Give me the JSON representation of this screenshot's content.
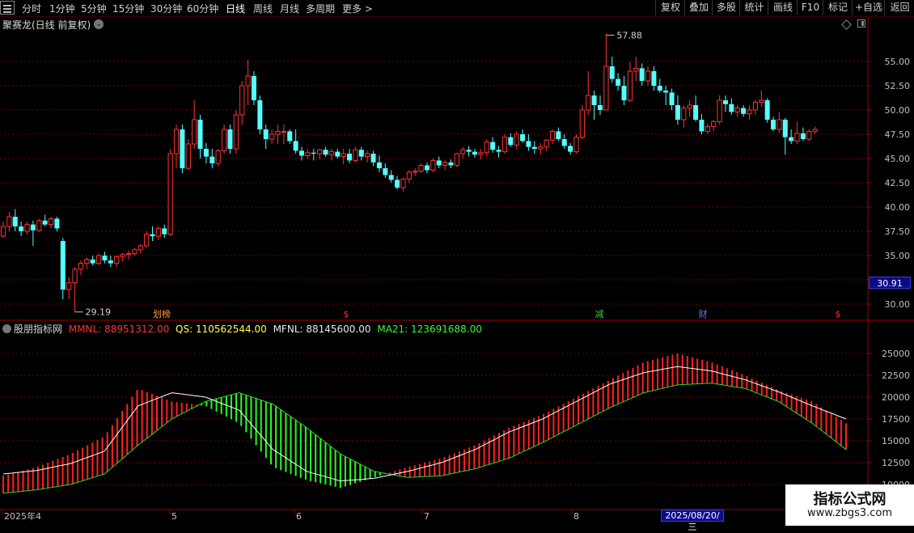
{
  "toolbar": {
    "periods": [
      {
        "label": "分时",
        "active": false
      },
      {
        "label": "1分钟",
        "active": false
      },
      {
        "label": "5分钟",
        "active": false
      },
      {
        "label": "15分钟",
        "active": false
      },
      {
        "label": "30分钟",
        "active": false
      },
      {
        "label": "60分钟",
        "active": false
      },
      {
        "label": "日线",
        "active": true
      },
      {
        "label": "周线",
        "active": false
      },
      {
        "label": "月线",
        "active": false
      },
      {
        "label": "多周期",
        "active": false
      }
    ],
    "more_label": "更多 >",
    "right_buttons": [
      "复权",
      "叠加",
      "多股",
      "统计",
      "画线",
      "F10",
      "标记",
      "+自选",
      "返回"
    ]
  },
  "stock": {
    "title": "聚赛龙(日线 前复权)",
    "last_price": "30.91",
    "high_marker": "57.88",
    "low_marker": "29.19"
  },
  "event_markers": [
    {
      "label": "划榜",
      "color": "#ff9a3c"
    },
    {
      "label": "$",
      "color": "#ff3030"
    },
    {
      "label": "减",
      "color": "#30d030"
    },
    {
      "label": "财",
      "color": "#6080ff"
    },
    {
      "label": "$",
      "color": "#ff3030"
    }
  ],
  "price_axis": {
    "labels": [
      "55.00",
      "52.50",
      "50.00",
      "47.50",
      "45.00",
      "42.50",
      "40.00",
      "37.50",
      "35.00",
      "32.50",
      "30.00"
    ],
    "min": 28.5,
    "max": 59.5
  },
  "indicator": {
    "name": "股朋指标网",
    "items": [
      {
        "label": "MMNL: 88951312.00",
        "color": "#ff3333"
      },
      {
        "label": "QS: 110562544.00",
        "color": "#ffff55"
      },
      {
        "label": "MFNL: 88145600.00",
        "color": "#e8e8e8"
      },
      {
        "label": "MA21: 123691688.00",
        "color": "#33ff33"
      }
    ],
    "axis_labels": [
      "25000",
      "22500",
      "20000",
      "17500",
      "15000",
      "12500",
      "10000"
    ]
  },
  "date_axis": {
    "labels": [
      "2025年4",
      "5",
      "6",
      "7",
      "8"
    ],
    "cursor_date": "2025/08/20/三"
  },
  "watermark": {
    "line1": "指标公式网",
    "line2": "www.zbgs3.com"
  },
  "colors": {
    "up": "#ff3232",
    "down": "#54ffff",
    "grid": "#7a0000",
    "ma21": "#22dd22",
    "mfnl": "#ffffff",
    "bar_up": "#ff2020",
    "bar_down": "#22ff22"
  },
  "chart_data": [
    {
      "type": "candlestick",
      "title": "聚赛龙(日线 前复权)",
      "ylim": [
        28.5,
        59.5
      ],
      "candles": [
        [
          37.0,
          38.5,
          36.8,
          38.0
        ],
        [
          38.0,
          39.5,
          37.5,
          39.0
        ],
        [
          39.0,
          39.8,
          37.5,
          38.0
        ],
        [
          38.0,
          38.5,
          37.0,
          37.5
        ],
        [
          37.5,
          38.5,
          37.2,
          38.2
        ],
        [
          38.2,
          38.6,
          36.0,
          37.6
        ],
        [
          37.6,
          38.8,
          37.4,
          38.6
        ],
        [
          38.6,
          39.2,
          38.0,
          38.2
        ],
        [
          38.2,
          39.0,
          37.8,
          38.8
        ],
        [
          38.8,
          39.0,
          37.5,
          37.8
        ],
        [
          36.5,
          36.8,
          30.5,
          31.5
        ],
        [
          31.5,
          32.8,
          30.5,
          32.2
        ],
        [
          32.2,
          33.8,
          29.19,
          33.6
        ],
        [
          33.6,
          34.5,
          33.0,
          34.2
        ],
        [
          34.2,
          34.8,
          33.6,
          34.6
        ],
        [
          34.6,
          35.0,
          34.0,
          34.2
        ],
        [
          34.2,
          35.2,
          34.0,
          35.0
        ],
        [
          35.0,
          35.4,
          34.2,
          34.5
        ],
        [
          34.5,
          35.0,
          33.8,
          34.2
        ],
        [
          34.2,
          35.0,
          33.8,
          34.9
        ],
        [
          34.9,
          35.3,
          34.4,
          35.1
        ],
        [
          35.1,
          35.5,
          34.6,
          35.2
        ],
        [
          35.2,
          35.8,
          35.0,
          35.6
        ],
        [
          35.6,
          36.2,
          35.2,
          36.0
        ],
        [
          36.0,
          37.5,
          35.8,
          37.2
        ],
        [
          37.2,
          38.0,
          36.5,
          37.0
        ],
        [
          37.0,
          38.0,
          36.6,
          37.8
        ],
        [
          37.8,
          38.2,
          36.8,
          37.2
        ],
        [
          37.2,
          46.0,
          37.0,
          45.5
        ],
        [
          45.5,
          48.5,
          44.0,
          48.0
        ],
        [
          48.0,
          48.5,
          43.5,
          44.0
        ],
        [
          44.0,
          47.0,
          43.8,
          46.5
        ],
        [
          46.5,
          51.0,
          46.0,
          49.0
        ],
        [
          49.0,
          49.5,
          45.0,
          46.0
        ],
        [
          46.0,
          46.6,
          44.5,
          45.2
        ],
        [
          45.2,
          46.0,
          44.0,
          44.5
        ],
        [
          44.5,
          46.0,
          44.2,
          45.8
        ],
        [
          45.8,
          48.5,
          45.5,
          48.0
        ],
        [
          48.0,
          48.5,
          45.5,
          46.0
        ],
        [
          46.0,
          50.0,
          45.5,
          49.5
        ],
        [
          49.5,
          53.0,
          48.5,
          52.5
        ],
        [
          52.5,
          55.2,
          50.5,
          53.5
        ],
        [
          53.5,
          54.0,
          50.5,
          51.0
        ],
        [
          51.0,
          51.5,
          47.5,
          48.0
        ],
        [
          48.0,
          48.5,
          46.0,
          47.0
        ],
        [
          47.0,
          48.0,
          46.5,
          47.5
        ],
        [
          47.5,
          48.5,
          46.5,
          47.8
        ],
        [
          47.8,
          48.5,
          46.5,
          47.8
        ],
        [
          47.8,
          48.0,
          46.5,
          46.8
        ],
        [
          46.8,
          48.0,
          45.5,
          45.8
        ],
        [
          45.8,
          46.2,
          44.8,
          45.3
        ],
        [
          45.3,
          46.0,
          45.0,
          45.6
        ],
        [
          45.6,
          46.0,
          44.8,
          45.5
        ],
        [
          45.5,
          46.0,
          44.9,
          45.9
        ],
        [
          45.9,
          46.2,
          45.2,
          45.4
        ],
        [
          45.4,
          46.0,
          44.8,
          45.7
        ],
        [
          45.7,
          46.0,
          45.0,
          45.2
        ],
        [
          45.2,
          46.0,
          44.4,
          45.5
        ],
        [
          45.5,
          46.0,
          44.5,
          44.8
        ],
        [
          44.8,
          46.2,
          44.6,
          45.9
        ],
        [
          45.9,
          46.2,
          44.8,
          45.2
        ],
        [
          45.2,
          45.8,
          44.6,
          45.5
        ],
        [
          45.5,
          45.8,
          44.2,
          44.6
        ],
        [
          44.6,
          45.3,
          43.6,
          44.0
        ],
        [
          44.0,
          44.5,
          43.0,
          43.3
        ],
        [
          43.3,
          43.8,
          42.5,
          42.8
        ],
        [
          42.8,
          43.2,
          41.8,
          42.0
        ],
        [
          42.0,
          43.0,
          41.6,
          42.9
        ],
        [
          42.9,
          43.8,
          42.5,
          43.6
        ],
        [
          43.6,
          44.0,
          43.2,
          43.7
        ],
        [
          43.7,
          44.5,
          43.5,
          44.3
        ],
        [
          44.3,
          44.6,
          43.5,
          43.8
        ],
        [
          43.8,
          45.0,
          43.6,
          44.8
        ],
        [
          44.8,
          45.2,
          44.0,
          44.3
        ],
        [
          44.3,
          44.8,
          43.8,
          44.6
        ],
        [
          44.6,
          44.9,
          44.0,
          44.3
        ],
        [
          44.3,
          45.6,
          44.1,
          45.5
        ],
        [
          45.5,
          46.2,
          45.0,
          45.9
        ],
        [
          45.9,
          46.3,
          45.2,
          45.7
        ],
        [
          45.7,
          46.0,
          45.1,
          45.4
        ],
        [
          45.4,
          46.0,
          44.9,
          45.6
        ],
        [
          45.6,
          47.0,
          45.2,
          46.7
        ],
        [
          46.7,
          47.2,
          45.6,
          45.9
        ],
        [
          45.9,
          46.3,
          45.1,
          45.7
        ],
        [
          45.7,
          47.5,
          45.5,
          47.2
        ],
        [
          47.2,
          47.6,
          46.2,
          46.4
        ],
        [
          46.4,
          47.8,
          46.0,
          47.5
        ],
        [
          47.5,
          48.0,
          46.6,
          46.8
        ],
        [
          46.8,
          47.5,
          45.8,
          46.2
        ],
        [
          46.2,
          46.8,
          45.5,
          46.0
        ],
        [
          46.0,
          46.6,
          45.4,
          46.2
        ],
        [
          46.2,
          47.0,
          45.8,
          46.9
        ],
        [
          46.9,
          48.0,
          46.5,
          47.8
        ],
        [
          47.8,
          48.2,
          46.8,
          47.0
        ],
        [
          47.0,
          47.5,
          46.0,
          46.3
        ],
        [
          46.3,
          46.6,
          45.4,
          45.7
        ],
        [
          45.7,
          47.5,
          45.5,
          47.2
        ],
        [
          47.2,
          50.5,
          47.0,
          50.0
        ],
        [
          50.0,
          54.0,
          49.5,
          51.5
        ],
        [
          51.5,
          52.0,
          49.0,
          50.5
        ],
        [
          50.5,
          51.5,
          49.5,
          50.0
        ],
        [
          50.0,
          57.88,
          50.0,
          54.5
        ],
        [
          54.5,
          55.5,
          52.8,
          53.2
        ],
        [
          53.2,
          53.8,
          52.0,
          52.5
        ],
        [
          52.5,
          53.5,
          50.5,
          51.0
        ],
        [
          51.0,
          55.0,
          50.8,
          54.0
        ],
        [
          54.0,
          55.5,
          53.0,
          54.3
        ],
        [
          54.3,
          54.8,
          52.5,
          53.0
        ],
        [
          53.0,
          54.5,
          52.5,
          54.0
        ],
        [
          54.0,
          54.5,
          52.0,
          52.5
        ],
        [
          52.5,
          53.2,
          51.8,
          52.0
        ],
        [
          52.0,
          52.5,
          50.5,
          51.8
        ],
        [
          51.8,
          52.2,
          50.0,
          50.5
        ],
        [
          50.5,
          51.5,
          48.5,
          49.0
        ],
        [
          49.0,
          50.5,
          48.2,
          50.2
        ],
        [
          50.2,
          51.0,
          49.3,
          50.5
        ],
        [
          50.5,
          51.5,
          48.8,
          49.0
        ],
        [
          49.0,
          49.6,
          47.5,
          47.8
        ],
        [
          47.8,
          48.6,
          47.5,
          48.3
        ],
        [
          48.3,
          49.0,
          47.8,
          48.8
        ],
        [
          48.8,
          51.5,
          48.5,
          51.0
        ],
        [
          51.0,
          51.5,
          49.8,
          50.6
        ],
        [
          50.6,
          51.2,
          49.5,
          49.8
        ],
        [
          49.8,
          50.5,
          49.3,
          50.2
        ],
        [
          50.2,
          50.5,
          49.3,
          49.6
        ],
        [
          49.6,
          50.5,
          49.0,
          50.0
        ],
        [
          50.0,
          51.0,
          49.5,
          50.8
        ],
        [
          50.8,
          52.0,
          50.3,
          51.0
        ],
        [
          51.0,
          51.2,
          48.7,
          49.0
        ],
        [
          49.0,
          49.3,
          47.8,
          48.0
        ],
        [
          48.0,
          49.8,
          47.6,
          49.0
        ],
        [
          49.0,
          49.2,
          45.4,
          47.2
        ],
        [
          47.2,
          48.0,
          46.5,
          46.8
        ],
        [
          46.8,
          48.8,
          46.5,
          47.6
        ],
        [
          47.6,
          48.2,
          46.8,
          47.0
        ],
        [
          47.0,
          48.0,
          46.8,
          47.8
        ],
        [
          47.8,
          48.3,
          47.5,
          48.0
        ]
      ]
    },
    {
      "type": "bar",
      "title": "股朋指标网",
      "ylim": [
        7500,
        27500
      ],
      "series": [
        {
          "name": "MMNL",
          "values": [
            11000,
            12000,
            13500,
            15500,
            21000,
            19500,
            19000,
            17000,
            12000,
            10500,
            9600,
            10800,
            12000,
            13000,
            14500,
            16500,
            18000,
            20000,
            22000,
            24000,
            25000,
            24000,
            22500,
            20800,
            19500,
            17000
          ]
        },
        {
          "name": "MFNL",
          "values": [
            11200,
            11600,
            12400,
            13800,
            19000,
            20500,
            20000,
            18500,
            14000,
            11500,
            10400,
            10700,
            11500,
            12500,
            14000,
            16000,
            17500,
            19500,
            21500,
            22800,
            23500,
            23000,
            22000,
            20600,
            19000,
            17500
          ]
        },
        {
          "name": "MA21",
          "values": [
            9000,
            9400,
            10000,
            11200,
            14500,
            17500,
            19500,
            20500,
            19200,
            16500,
            13500,
            11500,
            10800,
            11000,
            11800,
            13000,
            14800,
            16800,
            18800,
            20500,
            21400,
            21600,
            21000,
            19500,
            17000,
            14000
          ]
        }
      ]
    }
  ]
}
